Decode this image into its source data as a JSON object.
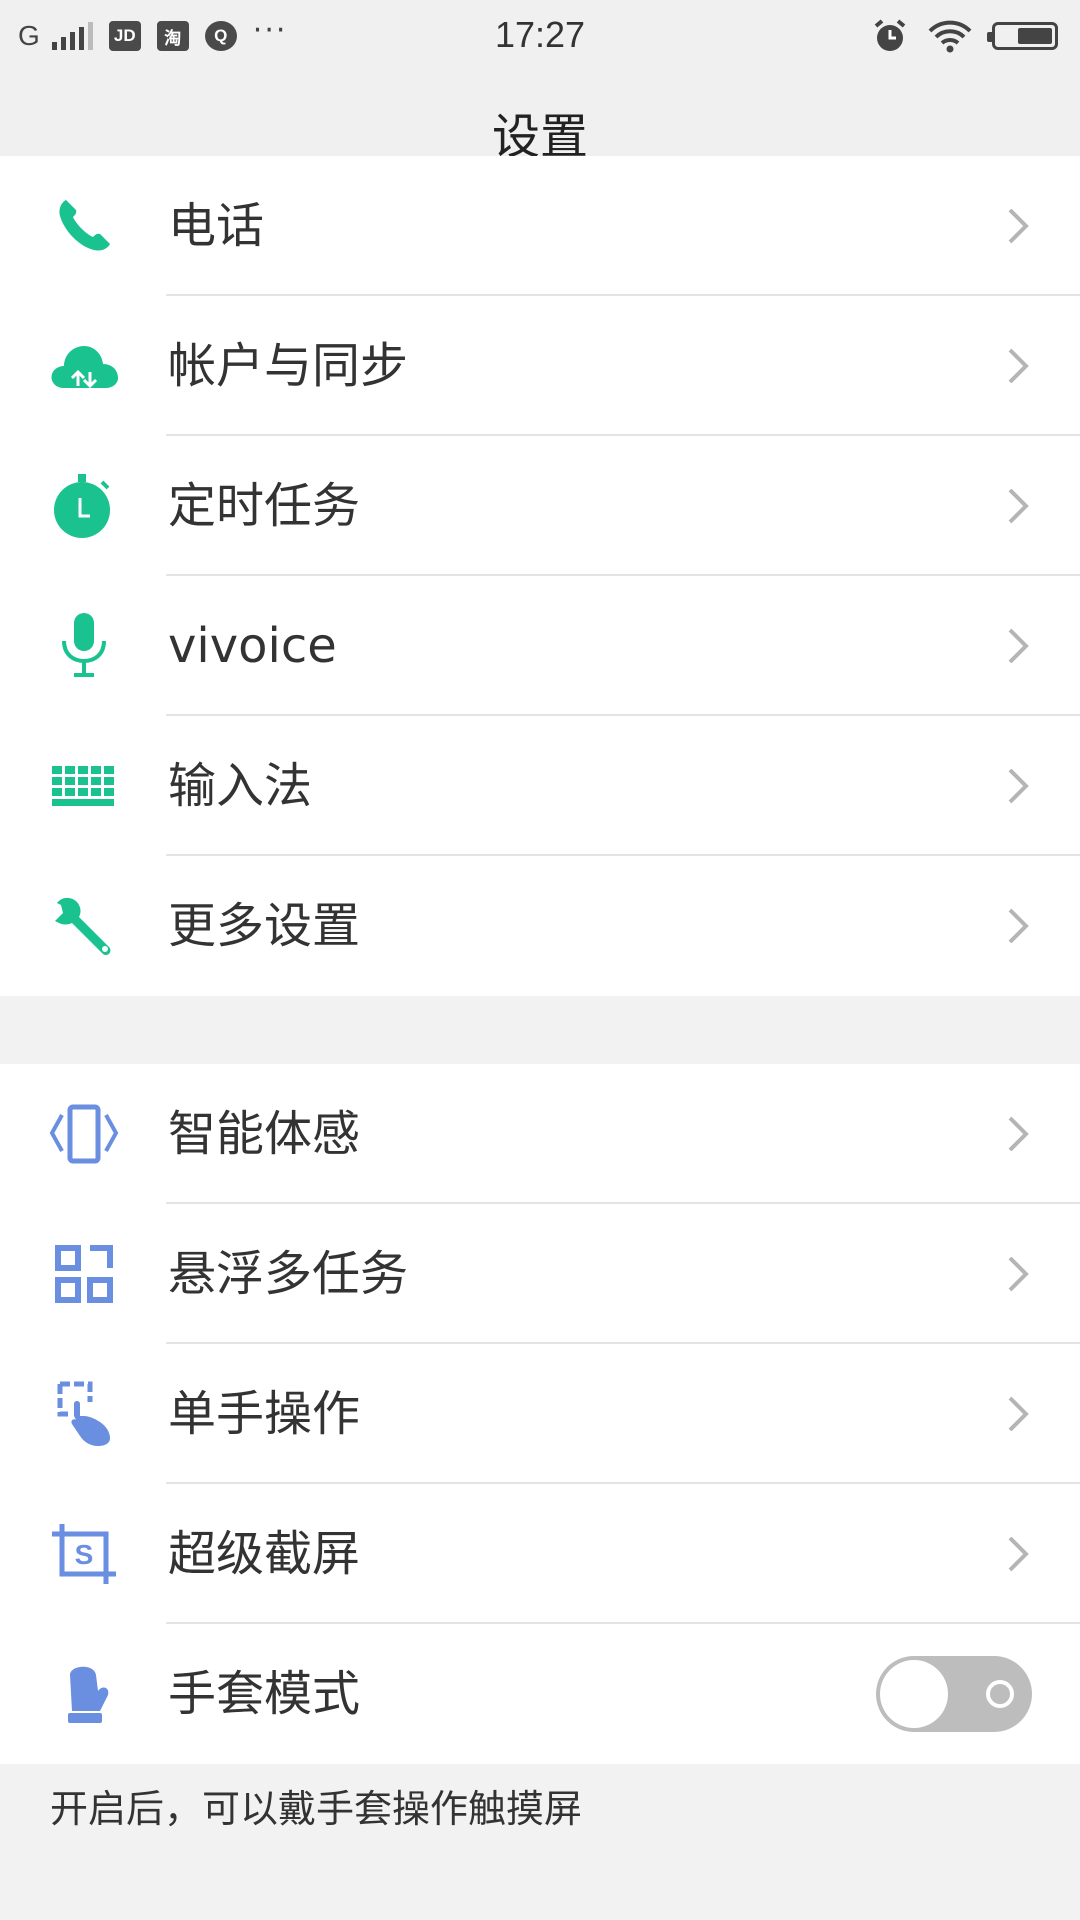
{
  "status_bar": {
    "carrier": "G",
    "apps": [
      "JD",
      "淘",
      "Q"
    ],
    "more": "···",
    "time": "17:27",
    "icons": [
      "alarm-icon",
      "wifi-icon",
      "battery-icon"
    ]
  },
  "header": {
    "title": "设置"
  },
  "group1": {
    "items": [
      {
        "label": "电话",
        "icon": "phone-icon"
      },
      {
        "label": "帐户与同步",
        "icon": "cloud-sync-icon"
      },
      {
        "label": "定时任务",
        "icon": "timer-icon"
      },
      {
        "label": "vivoice",
        "icon": "microphone-icon"
      },
      {
        "label": "输入法",
        "icon": "keyboard-icon"
      },
      {
        "label": "更多设置",
        "icon": "wrench-icon"
      }
    ]
  },
  "group2": {
    "items": [
      {
        "label": "智能体感",
        "icon": "motion-sense-icon"
      },
      {
        "label": "悬浮多任务",
        "icon": "floating-multitask-icon"
      },
      {
        "label": "单手操作",
        "icon": "one-hand-icon"
      },
      {
        "label": "超级截屏",
        "icon": "screenshot-icon"
      },
      {
        "label": "手套模式",
        "icon": "glove-icon",
        "toggle": false
      }
    ]
  },
  "footnote": "开启后，可以戴手套操作触摸屏",
  "colors": {
    "green_accent": "#19c28f",
    "blue_accent": "#6a8ee0",
    "chevron": "#b5b5b5",
    "toggle_off": "#bdbdbd"
  }
}
